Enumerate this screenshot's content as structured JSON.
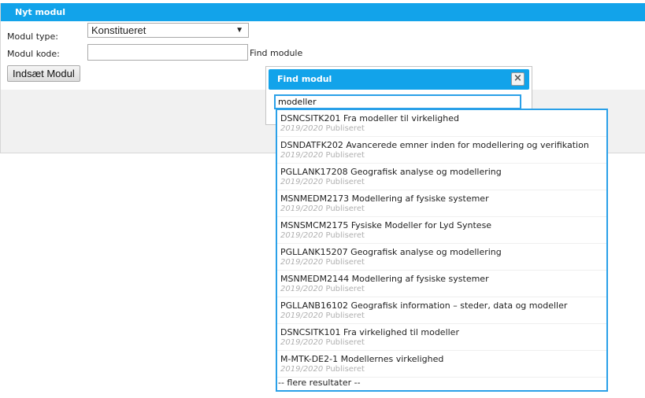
{
  "panel": {
    "title": "Nyt modul",
    "modul_type_label": "Modul type:",
    "modul_type_value": "Konstitueret",
    "modul_kode_label": "Modul kode:",
    "modul_kode_value": "",
    "find_module_link": "Find module",
    "insert_button": "Indsæt Modul"
  },
  "dialog": {
    "title": "Find modul",
    "close_symbol": "×",
    "search_value": "modeller",
    "results": [
      {
        "title": "DSNCSITK201 Fra modeller til virkelighed",
        "year": "2019/2020",
        "status": "Publiseret"
      },
      {
        "title": "DSNDATFK202 Avancerede emner inden for modellering og verifikation",
        "year": "2019/2020",
        "status": "Publiseret"
      },
      {
        "title": "PGLLANK17208 Geografisk analyse og modellering",
        "year": "2019/2020",
        "status": "Publiseret"
      },
      {
        "title": "MSNMEDM2173 Modellering af fysiske systemer",
        "year": "2019/2020",
        "status": "Publiseret"
      },
      {
        "title": "MSNSMCM2175 Fysiske Modeller for Lyd Syntese",
        "year": "2019/2020",
        "status": "Publiseret"
      },
      {
        "title": "PGLLANK15207 Geografisk analyse og modellering",
        "year": "2019/2020",
        "status": "Publiseret"
      },
      {
        "title": "MSNMEDM2144 Modellering af fysiske systemer",
        "year": "2019/2020",
        "status": "Publiseret"
      },
      {
        "title": "PGLLANB16102 Geografisk information – steder, data og modeller",
        "year": "2019/2020",
        "status": "Publiseret"
      },
      {
        "title": "DSNCSITK101 Fra virkelighed til modeller",
        "year": "2019/2020",
        "status": "Publiseret"
      },
      {
        "title": "M-MTK-DE2-1 Modellernes virkelighed",
        "year": "2019/2020",
        "status": "Publiseret"
      }
    ],
    "more_results": "-- flere resultater --"
  },
  "colors": {
    "accent": "#12a3ea",
    "results_border": "#2aa0e8",
    "meta_text": "#b0b0b0"
  }
}
